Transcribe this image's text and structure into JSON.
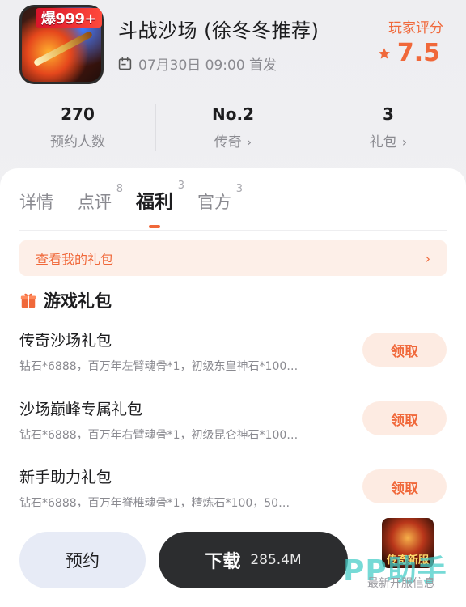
{
  "header": {
    "icon_badge": "爆999+",
    "title": "斗战沙场 (徐冬冬推荐)",
    "release": "07月30日 09:00 首发",
    "rating_label": "玩家评分",
    "rating_value": "7.5"
  },
  "stats": [
    {
      "value": "270",
      "label": "预约人数",
      "chevron": ""
    },
    {
      "value": "No.2",
      "label": "传奇",
      "chevron": "›"
    },
    {
      "value": "3",
      "label": "礼包",
      "chevron": "›"
    }
  ],
  "tabs": [
    {
      "label": "详情",
      "count": ""
    },
    {
      "label": "点评",
      "count": "8"
    },
    {
      "label": "福利",
      "count": "3"
    },
    {
      "label": "官方",
      "count": "3"
    }
  ],
  "my_gifts": {
    "label": "查看我的礼包",
    "chevron": "›"
  },
  "section": {
    "title": "游戏礼包"
  },
  "gifts": [
    {
      "name": "传奇沙场礼包",
      "desc": "钻石*6888，百万年左臂魂骨*1，初级东皇神石*100…",
      "button": "领取"
    },
    {
      "name": "沙场巅峰专属礼包",
      "desc": "钻石*6888，百万年右臂魂骨*1，初级昆仑神石*100…",
      "button": "领取"
    },
    {
      "name": "新手助力礼包",
      "desc": "钻石*6888，百万年脊椎魂骨*1，精炼石*100，50…",
      "button": "领取"
    }
  ],
  "bottom": {
    "reserve": "预约",
    "download": "下载",
    "download_size": "285.4M"
  },
  "overlay": {
    "promo_text": "传奇新服",
    "watermark": "PP助手",
    "watermark_sub": "最新开服信息"
  },
  "colors": {
    "accent": "#f0683a",
    "dark_button": "#2c2d2f"
  }
}
